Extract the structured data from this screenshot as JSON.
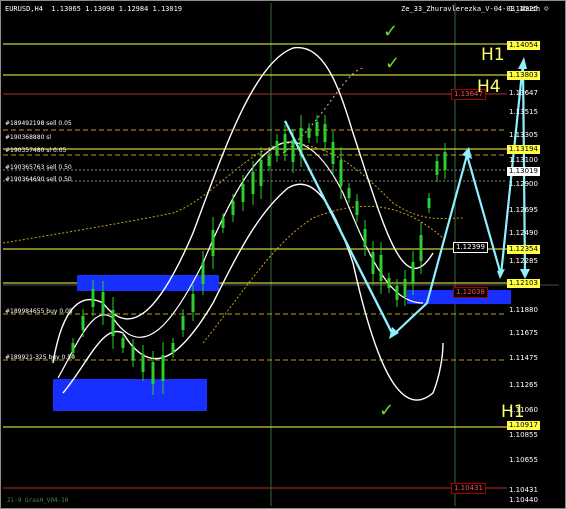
{
  "header": {
    "symbol": "EURUSD,H4",
    "ohlc": "1.13065 1.13090 1.12984 1.13019",
    "indicator_name": "Ze_33_Zhuravlerezka_V-04-03_1bush",
    "indicator_icon": "smiley-icon"
  },
  "price_axis": [
    "1.14325",
    "1.14054",
    "1.13803",
    "1.13647",
    "1.13515",
    "1.13305",
    "1.13194",
    "1.13100",
    "1.13019",
    "1.12900",
    "1.12695",
    "1.12490",
    "1.12399",
    "1.12354",
    "1.12285",
    "1.12103",
    "1.11880",
    "1.11675",
    "1.11475",
    "1.11265",
    "1.11060",
    "1.10917",
    "1.10855",
    "1.10655",
    "1.10431",
    "1.10440"
  ],
  "price_tags": {
    "level_136": "1.13647",
    "level_124": "1.12399",
    "level_120": "1.12038",
    "level_104": "1.10431"
  },
  "orders": [
    "#189492198 sell 0.05",
    "#190368880 sl",
    "#190357480 sl 0.05",
    "#190365763 sell 0.50",
    "#190364690 sell 0.50",
    "#189984655 buy 0.05",
    "#189921-325 buy 0.50"
  ],
  "annotations": {
    "h1_top": "H1",
    "h4": "H4",
    "h1_bottom": "H1",
    "check_glyph": "✓"
  },
  "footer_label": "Zi-9 GrasH_V04-10",
  "colors": {
    "background": "#000000",
    "level_line": "#ffff44",
    "candle": "#2ecc2e",
    "band": "#ffffff",
    "arrow": "#8ef0ff",
    "zone": "#1830ff"
  }
}
